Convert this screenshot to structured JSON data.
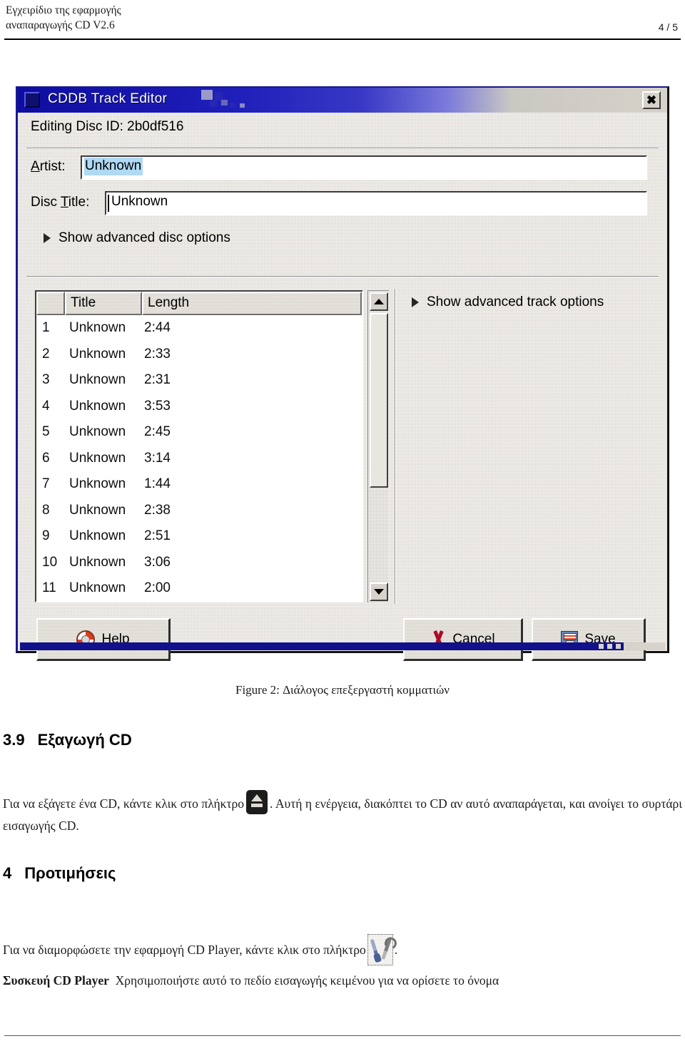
{
  "document_header": {
    "title": "Εγχειρίδιο της εφαρμογής\nαναπαραγωγής CD V2.6",
    "page_indicator": "4 / 5"
  },
  "dialog": {
    "title": "CDDB Track Editor",
    "close_label": "✖",
    "editing_line": "Editing Disc ID: 2b0df516",
    "artist": {
      "label_pre": "",
      "label": "Artist:",
      "value": "Unknown",
      "selected": true
    },
    "disc_title": {
      "label": "Disc Title:",
      "value": "Unknown",
      "selected": false
    },
    "advanced_disc_options": "Show advanced disc options",
    "advanced_track_options": "Show advanced track options",
    "track_list": {
      "columns": [
        "",
        "Title",
        "Length"
      ],
      "rows": [
        {
          "num": "1",
          "title": "Unknown",
          "length": "2:44"
        },
        {
          "num": "2",
          "title": "Unknown",
          "length": "2:33"
        },
        {
          "num": "3",
          "title": "Unknown",
          "length": "2:31"
        },
        {
          "num": "4",
          "title": "Unknown",
          "length": "3:53"
        },
        {
          "num": "5",
          "title": "Unknown",
          "length": "2:45"
        },
        {
          "num": "6",
          "title": "Unknown",
          "length": "3:14"
        },
        {
          "num": "7",
          "title": "Unknown",
          "length": "1:44"
        },
        {
          "num": "8",
          "title": "Unknown",
          "length": "2:38"
        },
        {
          "num": "9",
          "title": "Unknown",
          "length": "2:51"
        },
        {
          "num": "10",
          "title": "Unknown",
          "length": "3:06"
        },
        {
          "num": "11",
          "title": "Unknown",
          "length": "2:00"
        }
      ]
    },
    "buttons": {
      "help": "Help",
      "cancel": "Cancel",
      "save": "Save"
    },
    "colors": {
      "titlebar_blue": "#2222b8",
      "face": "#d4d0c8",
      "selection_blue": "#aed6f1",
      "bottom_strip": "#14148c"
    }
  },
  "body": {
    "figure_caption": "Figure 2: Διάλογος επεξεργαστή κομματιών",
    "section_39": {
      "number": "3.9",
      "title": "Εξαγωγή CD"
    },
    "paragraph_eject_before": "Για να εξάγετε ένα CD, κάντε κλικ στο πλήκτρο",
    "paragraph_eject_after": ". Αυτή η ενέργεια, διακόπτει το CD αν αυτό αναπαράγεται, και ανοίγει το συρτάρι εισαγωγής CD.",
    "section_4": {
      "number": "4",
      "title": "Προτιμήσεις"
    },
    "paragraph_prefs_before": "Για να διαμορφώσετε την εφαρμογή CD Player, κάντε κλικ στο πλήκτρο",
    "paragraph_prefs_after": ".",
    "definition_term": "Συσκευή CD Player",
    "definition_text": "Χρησιμοποιήστε αυτό το πεδίο εισαγωγής κειμένου για να ορίσετε το όνομα"
  }
}
